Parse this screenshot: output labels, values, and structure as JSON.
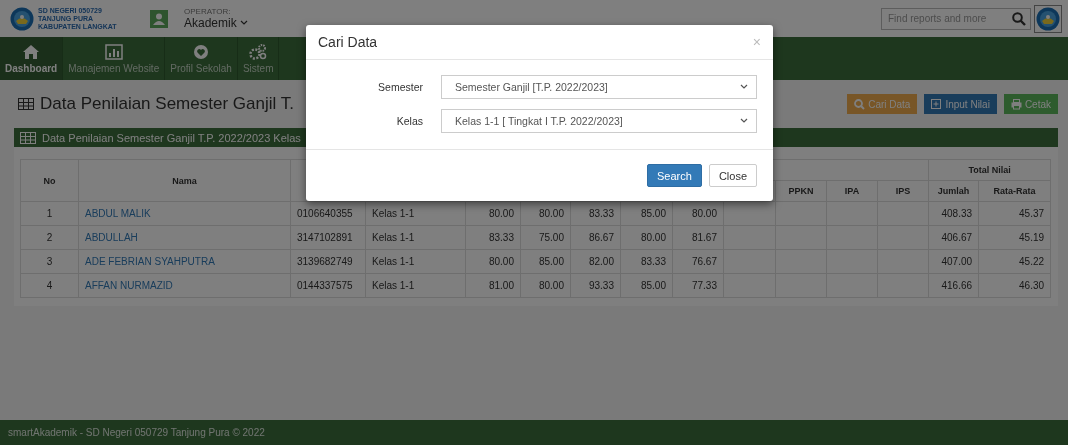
{
  "header": {
    "school_lines": [
      "SD NEGERI 050729",
      "TANJUNG PURA",
      "KABUPATEN LANGKAT"
    ],
    "role_label": "OPERATOR:",
    "user": "Akademik",
    "search": {
      "placeholder": "Find reports and more"
    }
  },
  "nav": [
    {
      "label": "Dashboard",
      "selected": true
    },
    {
      "label": "Manajemen Website",
      "selected": false
    },
    {
      "label": "Profil Sekolah",
      "selected": false
    },
    {
      "label": "Sistem",
      "selected": false
    }
  ],
  "page_title": "Data Penilaian Semester Ganjil T.",
  "actions": [
    {
      "label": "Cari Data",
      "kind": "search"
    },
    {
      "label": "Input Nilai",
      "kind": "input"
    },
    {
      "label": "Cetak",
      "kind": "print"
    }
  ],
  "panel_title": "Data Penilaian Semester Ganjil T.P. 2022/2023 Kelas",
  "table": {
    "col_no": "No",
    "col_name": "Nama",
    "subjects": [
      "PPKN",
      "IPA",
      "IPS"
    ],
    "total_group": "Total Nilai",
    "total_cols": [
      "Jumlah",
      "Rata-Rata"
    ],
    "rows": [
      {
        "no": "1",
        "name": "ABDUL MALIK",
        "nis": "0106640355",
        "kelas": "Kelas 1-1",
        "scores": [
          "80.00",
          "80.00",
          "83.33",
          "85.00",
          "80.00"
        ],
        "jumlah": "408.33",
        "rata": "45.37"
      },
      {
        "no": "2",
        "name": "ABDULLAH",
        "nis": "3147102891",
        "kelas": "Kelas 1-1",
        "scores": [
          "83.33",
          "75.00",
          "86.67",
          "80.00",
          "81.67"
        ],
        "jumlah": "406.67",
        "rata": "45.19"
      },
      {
        "no": "3",
        "name": "ADE FEBRIAN SYAHPUTRA",
        "nis": "3139682749",
        "kelas": "Kelas 1-1",
        "scores": [
          "80.00",
          "85.00",
          "82.00",
          "83.33",
          "76.67"
        ],
        "jumlah": "407.00",
        "rata": "45.22"
      },
      {
        "no": "4",
        "name": "AFFAN NURMAZID",
        "nis": "0144337575",
        "kelas": "Kelas 1-1",
        "scores": [
          "81.00",
          "80.00",
          "93.33",
          "85.00",
          "77.33"
        ],
        "jumlah": "416.66",
        "rata": "46.30"
      }
    ]
  },
  "footer": "smartAkademik - SD Negeri 050729 Tanjung Pura © 2022",
  "modal": {
    "title": "Cari Data",
    "close": "×",
    "fields": [
      {
        "label": "Semester",
        "value": "Semester Ganjil [T.P. 2022/2023]"
      },
      {
        "label": "Kelas",
        "value": "Kelas 1-1 [ Tingkat I T.P. 2022/2023]"
      }
    ],
    "buttons": [
      {
        "label": "Search",
        "kind": "primary"
      },
      {
        "label": "Close",
        "kind": "default"
      }
    ]
  }
}
